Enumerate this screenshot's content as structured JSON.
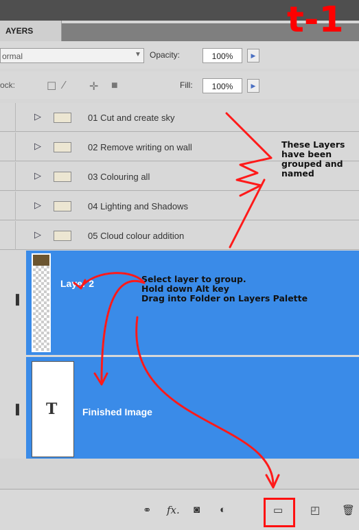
{
  "panel": {
    "tab_label": "AYERS",
    "handwritten_label": "t-1"
  },
  "options": {
    "blend_mode": "ormal",
    "opacity_label": "Opacity:",
    "opacity_value": "100%",
    "lock_label": "ock:",
    "fill_label": "Fill:",
    "fill_value": "100%"
  },
  "groups": [
    {
      "name": "01 Cut and create sky"
    },
    {
      "name": "02 Remove writing on wall"
    },
    {
      "name": "03 Colouring all"
    },
    {
      "name": "04 Lighting and Shadows"
    },
    {
      "name": "05 Cloud colour addition"
    }
  ],
  "layers": [
    {
      "name": "Layer 2"
    },
    {
      "name": "Finished Image",
      "thumb_glyph": "T"
    }
  ],
  "annotations": {
    "groups_note": [
      "These Layers",
      "have been",
      "grouped and",
      "named"
    ],
    "instructions": [
      "Select layer to group.",
      "Hold down Alt key",
      "Drag into Folder on Layers Palette"
    ]
  },
  "toolbar": {
    "icons": [
      "link-icon",
      "fx-icon",
      "mask-icon",
      "adjustment-icon",
      "new-group-icon",
      "new-layer-icon",
      "trash-icon"
    ],
    "fx_label": "fx."
  },
  "colors": {
    "selection": "#3a8be8",
    "annotation_red": "#ff0000"
  }
}
